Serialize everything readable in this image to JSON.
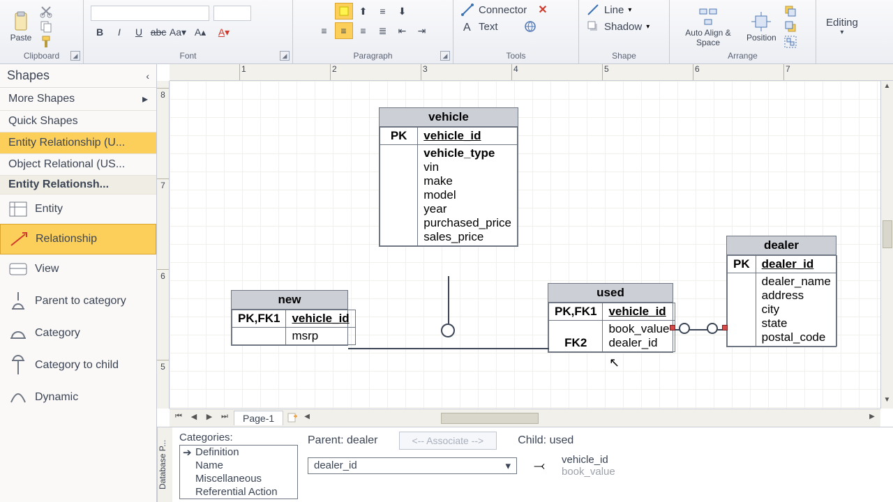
{
  "ribbon": {
    "clipboard": {
      "label": "Clipboard",
      "paste": "Paste"
    },
    "font": {
      "label": "Font"
    },
    "paragraph": {
      "label": "Paragraph"
    },
    "tools": {
      "label": "Tools",
      "connector": "Connector",
      "text": "Text",
      "close": "✕"
    },
    "shape": {
      "label": "Shape",
      "line": "Line",
      "shadow": "Shadow"
    },
    "arrange": {
      "label": "Arrange",
      "autoalign": "Auto Align & Space",
      "position": "Position"
    },
    "editing": {
      "label": "Editing"
    }
  },
  "hruler": [
    "1",
    "2",
    "3",
    "4",
    "5",
    "6",
    "7"
  ],
  "vruler": [
    "8",
    "7",
    "6",
    "5"
  ],
  "shapes": {
    "title": "Shapes",
    "more": "More Shapes",
    "quick": "Quick Shapes",
    "er": "Entity Relationship (U...",
    "or": "Object Relational (US...",
    "stencil_title": "Entity Relationsh...",
    "items": [
      "Entity",
      "Relationship",
      "View",
      "Parent to category",
      "Category",
      "Category to child",
      "Dynamic"
    ]
  },
  "canvas": {
    "vehicle": {
      "name": "vehicle",
      "pk_lbl": "PK",
      "pk": "vehicle_id",
      "attrs": [
        "vehicle_type",
        "vin",
        "make",
        "model",
        "year",
        "purchased_price",
        "sales_price"
      ]
    },
    "new": {
      "name": "new",
      "key_lbl": "PK,FK1",
      "pk": "vehicle_id",
      "attrs": [
        "msrp"
      ]
    },
    "used": {
      "name": "used",
      "key_lbl": "PK,FK1",
      "pk": "vehicle_id",
      "fk_lbl": "FK2",
      "attrs": [
        "book_value",
        "dealer_id"
      ]
    },
    "dealer": {
      "name": "dealer",
      "pk_lbl": "PK",
      "pk": "dealer_id",
      "attrs": [
        "dealer_name",
        "address",
        "city",
        "state",
        "postal_code"
      ]
    }
  },
  "pagetab": {
    "name": "Page-1"
  },
  "dbp": {
    "tab": "Database P...",
    "cat_hdr": "Categories:",
    "cats": [
      "Definition",
      "Name",
      "Miscellaneous",
      "Referential Action"
    ],
    "parent_lbl": "Parent: dealer",
    "assoc": "<-- Associate -->",
    "child_lbl": "Child: used",
    "parent_field": "dealer_id",
    "child_fields": [
      "vehicle_id",
      "book_value"
    ]
  }
}
